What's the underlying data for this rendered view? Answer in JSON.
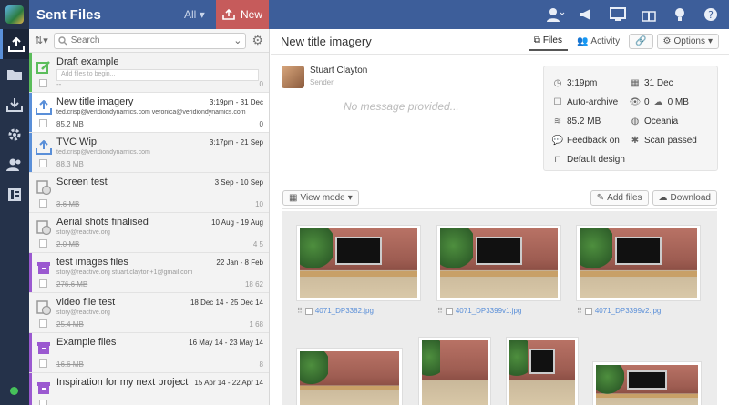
{
  "app": {
    "title": "Sent Files",
    "filter_label": "All",
    "new_label": "New",
    "colors": {
      "topbar": "#3d5e9a",
      "rail": "#25324a",
      "new_button": "#c65b5b",
      "link": "#5a8fd8"
    }
  },
  "rail": [
    {
      "name": "upload-icon",
      "glyph": "⇪"
    },
    {
      "name": "folder-icon",
      "glyph": "▰"
    },
    {
      "name": "inbox-icon",
      "glyph": "⤓"
    },
    {
      "name": "gear-icon",
      "glyph": "⚙"
    },
    {
      "name": "users-icon",
      "glyph": "👥"
    },
    {
      "name": "branding-icon",
      "glyph": "▤"
    }
  ],
  "topbar_icons": [
    "user-menu-icon",
    "megaphone-icon",
    "monitor-icon",
    "gift-icon",
    "lightbulb-icon",
    "help-icon"
  ],
  "list": {
    "search_placeholder": "Search",
    "items": [
      {
        "name": "Draft example",
        "date": "",
        "recipients": "",
        "draft_placeholder": "Add files to begin...",
        "size": "--",
        "count": "0",
        "type": "draft",
        "bar": "#5bbd5b"
      },
      {
        "name": "New title imagery",
        "date": "3:19pm - 31 Dec",
        "recipients": "ted.crisp@veridiondynamics.com  veronica@veridiondynamics.com",
        "size": "85.2 MB",
        "count": "0",
        "type": "sent",
        "selected": true,
        "bar": "#5a8fd8"
      },
      {
        "name": "TVC Wip",
        "date": "3:17pm - 21 Sep",
        "recipients": "ted.crisp@veridiondynamics.com",
        "size": "88.3 MB",
        "count": "",
        "type": "sent",
        "bar": "#5a8fd8"
      },
      {
        "name": "Screen test",
        "date": "3 Sep - 10 Sep",
        "recipients": "",
        "size": "3.6 MB",
        "count": "10",
        "type": "expired",
        "bar": ""
      },
      {
        "name": "Aerial shots finalised",
        "date": "10 Aug - 19 Aug",
        "recipients": "story@reactive.org",
        "size": "2.0 MB",
        "count": "4  5",
        "type": "expired",
        "bar": ""
      },
      {
        "name": "test images files",
        "date": "22 Jan - 8 Feb",
        "recipients": "story@reactive.org  stuart.clayton+1@gmail.com",
        "size": "276.6 MB",
        "count": "18  62",
        "type": "archive",
        "bar": "#9b59d0"
      },
      {
        "name": "video file test",
        "date": "18 Dec 14 - 25 Dec 14",
        "recipients": "story@reactive.org",
        "size": "25.4 MB",
        "count": "1  68",
        "type": "expired",
        "bar": ""
      },
      {
        "name": "Example files",
        "date": "16 May 14 - 23 May 14",
        "recipients": "",
        "size": "16.6 MB",
        "count": "8",
        "type": "archive",
        "bar": "#9b59d0"
      },
      {
        "name": "Inspiration for my next project",
        "date": "15 Apr 14 - 22 Apr 14",
        "recipients": "",
        "size": "",
        "count": "",
        "type": "archive",
        "bar": "#9b59d0"
      }
    ]
  },
  "main": {
    "title": "New title imagery",
    "tabs": {
      "files": "Files",
      "activity": "Activity",
      "options": "Options"
    },
    "sender_name": "Stuart Clayton",
    "sender_role": "Sender",
    "no_message": "No message provided...",
    "details": {
      "time": "3:19pm",
      "date": "31 Dec",
      "auto_archive": "Auto-archive",
      "downloads": "0",
      "download_size": "0 MB",
      "size": "85.2 MB",
      "region": "Oceania",
      "feedback": "Feedback on",
      "scan": "Scan passed",
      "design": "Default design"
    },
    "view_mode": "View mode",
    "add_files": "Add files",
    "download": "Download",
    "files": [
      {
        "name": "4071_DP3382.jpg"
      },
      {
        "name": "4071_DP3399v1.jpg"
      },
      {
        "name": "4071_DP3399v2.jpg"
      }
    ]
  }
}
